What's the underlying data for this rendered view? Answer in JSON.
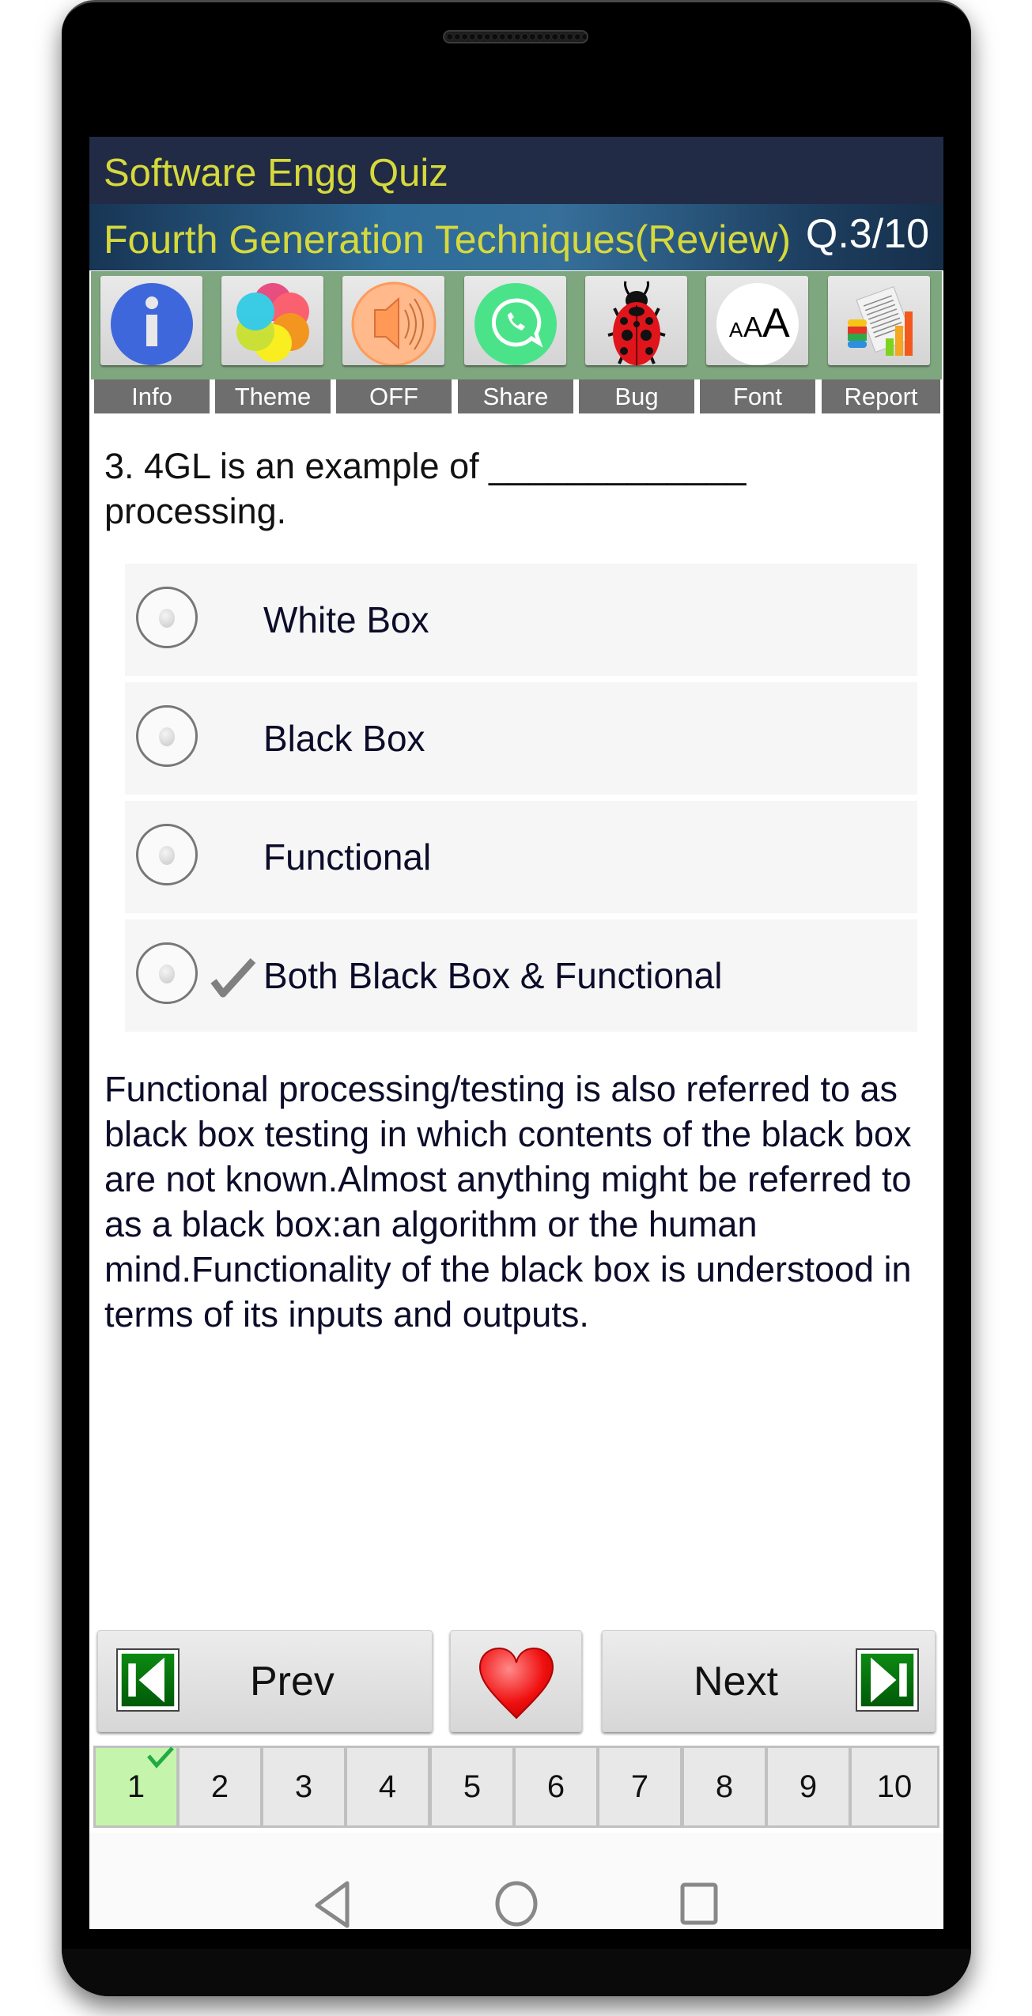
{
  "header": {
    "app_title": "Software Engg Quiz",
    "subtitle": "Fourth Generation Techniques(Review)",
    "question_counter": "Q.3/10"
  },
  "toolbar": [
    {
      "label": "Info",
      "icon": "info-icon"
    },
    {
      "label": "Theme",
      "icon": "theme-palette-icon"
    },
    {
      "label": "OFF",
      "icon": "speaker-icon"
    },
    {
      "label": "Share",
      "icon": "whatsapp-icon"
    },
    {
      "label": "Bug",
      "icon": "ladybug-icon"
    },
    {
      "label": "Font",
      "icon": "font-size-icon"
    },
    {
      "label": "Report",
      "icon": "report-chart-icon"
    }
  ],
  "question": {
    "text": "3. 4GL is an example of _____________ processing.",
    "options": [
      {
        "text": "White Box",
        "correct": false,
        "selected": false
      },
      {
        "text": "Black Box",
        "correct": false,
        "selected": false
      },
      {
        "text": "Functional",
        "correct": false,
        "selected": false
      },
      {
        "text": "Both Black Box & Functional",
        "correct": true,
        "selected": false
      }
    ],
    "explanation": "Functional processing/testing is also referred to as black box testing in which contents of the black box are not known.Almost anything might be referred to as a black box:an algorithm or the human mind.Functionality of the black box is understood in terms of its inputs and outputs."
  },
  "navigation": {
    "prev_label": "Prev",
    "next_label": "Next",
    "favorite_icon": "heart-icon"
  },
  "pages": [
    {
      "label": "1",
      "answered": true
    },
    {
      "label": "2",
      "answered": false
    },
    {
      "label": "3",
      "answered": false
    },
    {
      "label": "4",
      "answered": false
    },
    {
      "label": "5",
      "answered": false
    },
    {
      "label": "6",
      "answered": false
    },
    {
      "label": "7",
      "answered": false
    },
    {
      "label": "8",
      "answered": false
    },
    {
      "label": "9",
      "answered": false
    },
    {
      "label": "10",
      "answered": false
    }
  ],
  "colors": {
    "title_text": "#d6d93c",
    "toolbar_bg": "#7fa77f",
    "answered_page": "#c5f5ad",
    "check_green": "#22aa44"
  }
}
